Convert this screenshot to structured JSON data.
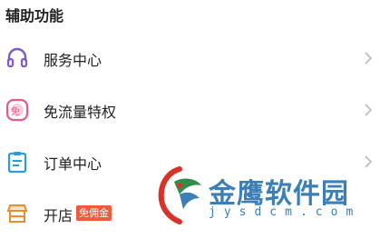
{
  "section": {
    "title": "辅助功能"
  },
  "items": [
    {
      "label": "服务中心",
      "icon": "headset-icon"
    },
    {
      "label": "免流量特权",
      "icon": "free-data-icon",
      "icon_glyph": "免"
    },
    {
      "label": "订单中心",
      "icon": "order-icon"
    },
    {
      "label": "开店",
      "icon": "store-icon",
      "badge": "免佣金"
    }
  ],
  "watermark": {
    "name": "金鹰软件园",
    "domain": "jysdcm.com"
  },
  "colors": {
    "headset": "#7b5cc9",
    "free_data": "#e85a8a",
    "order": "#2d9be0",
    "store": "#f08a2e",
    "badge": "#ef5a3a",
    "watermark": "#3b7fb6"
  }
}
